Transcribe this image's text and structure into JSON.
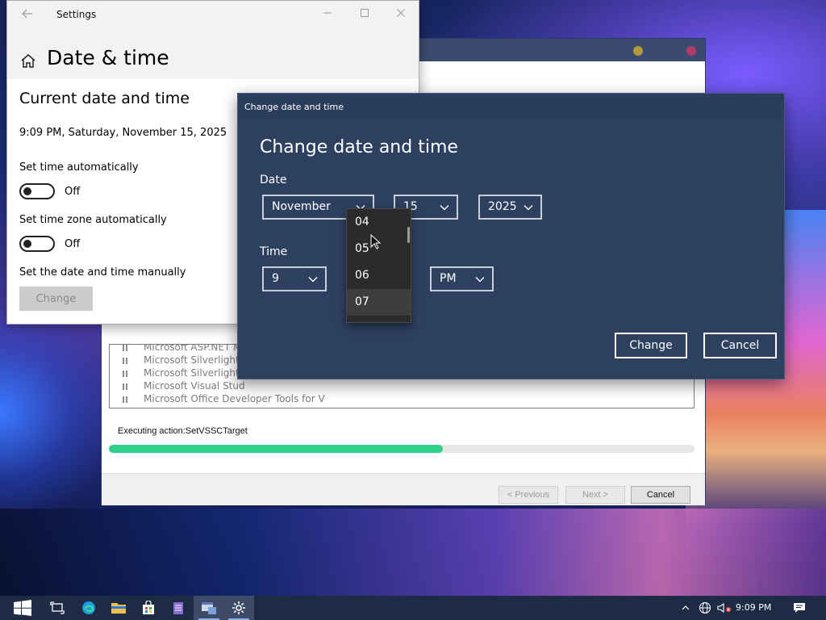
{
  "settings": {
    "app_title": "Settings",
    "page_title": "Date & time",
    "section_title": "Current date and time",
    "current_datetime": "9:09 PM, Saturday, November 15, 2025",
    "set_time_auto_label": "Set time automatically",
    "set_time_auto_state": "Off",
    "set_timezone_auto_label": "Set time zone automatically",
    "set_timezone_auto_state": "Off",
    "manual_label": "Set the date and time manually",
    "change_button": "Change"
  },
  "dialog": {
    "title": "Change date and time",
    "heading": "Change date and time",
    "date_label": "Date",
    "month": "November",
    "day": "15",
    "year": "2025",
    "time_label": "Time",
    "hour": "9",
    "ampm": "PM",
    "minute_options": [
      "04",
      "05",
      "06",
      "07"
    ],
    "minute_selected": "07",
    "change_button": "Change",
    "cancel_button": "Cancel"
  },
  "installer": {
    "features": [
      "Microsoft ASP.NET M",
      "Microsoft Silverlight",
      "Microsoft Silverlight",
      "Microsoft Visual Stud",
      "Microsoft Office Developer Tools for V"
    ],
    "status": "Executing action:SetVSSCTarget",
    "progress": 0.57,
    "previous_button": "< Previous",
    "next_button": "Next >",
    "cancel_button": "Cancel"
  },
  "taskbar": {
    "clock": "9:09 PM",
    "apps": [
      "start-icon",
      "task-view-icon",
      "edge-icon",
      "file-explorer-icon",
      "store-icon",
      "notepad-icon",
      "installer-app-icon",
      "settings-gear-icon"
    ]
  }
}
